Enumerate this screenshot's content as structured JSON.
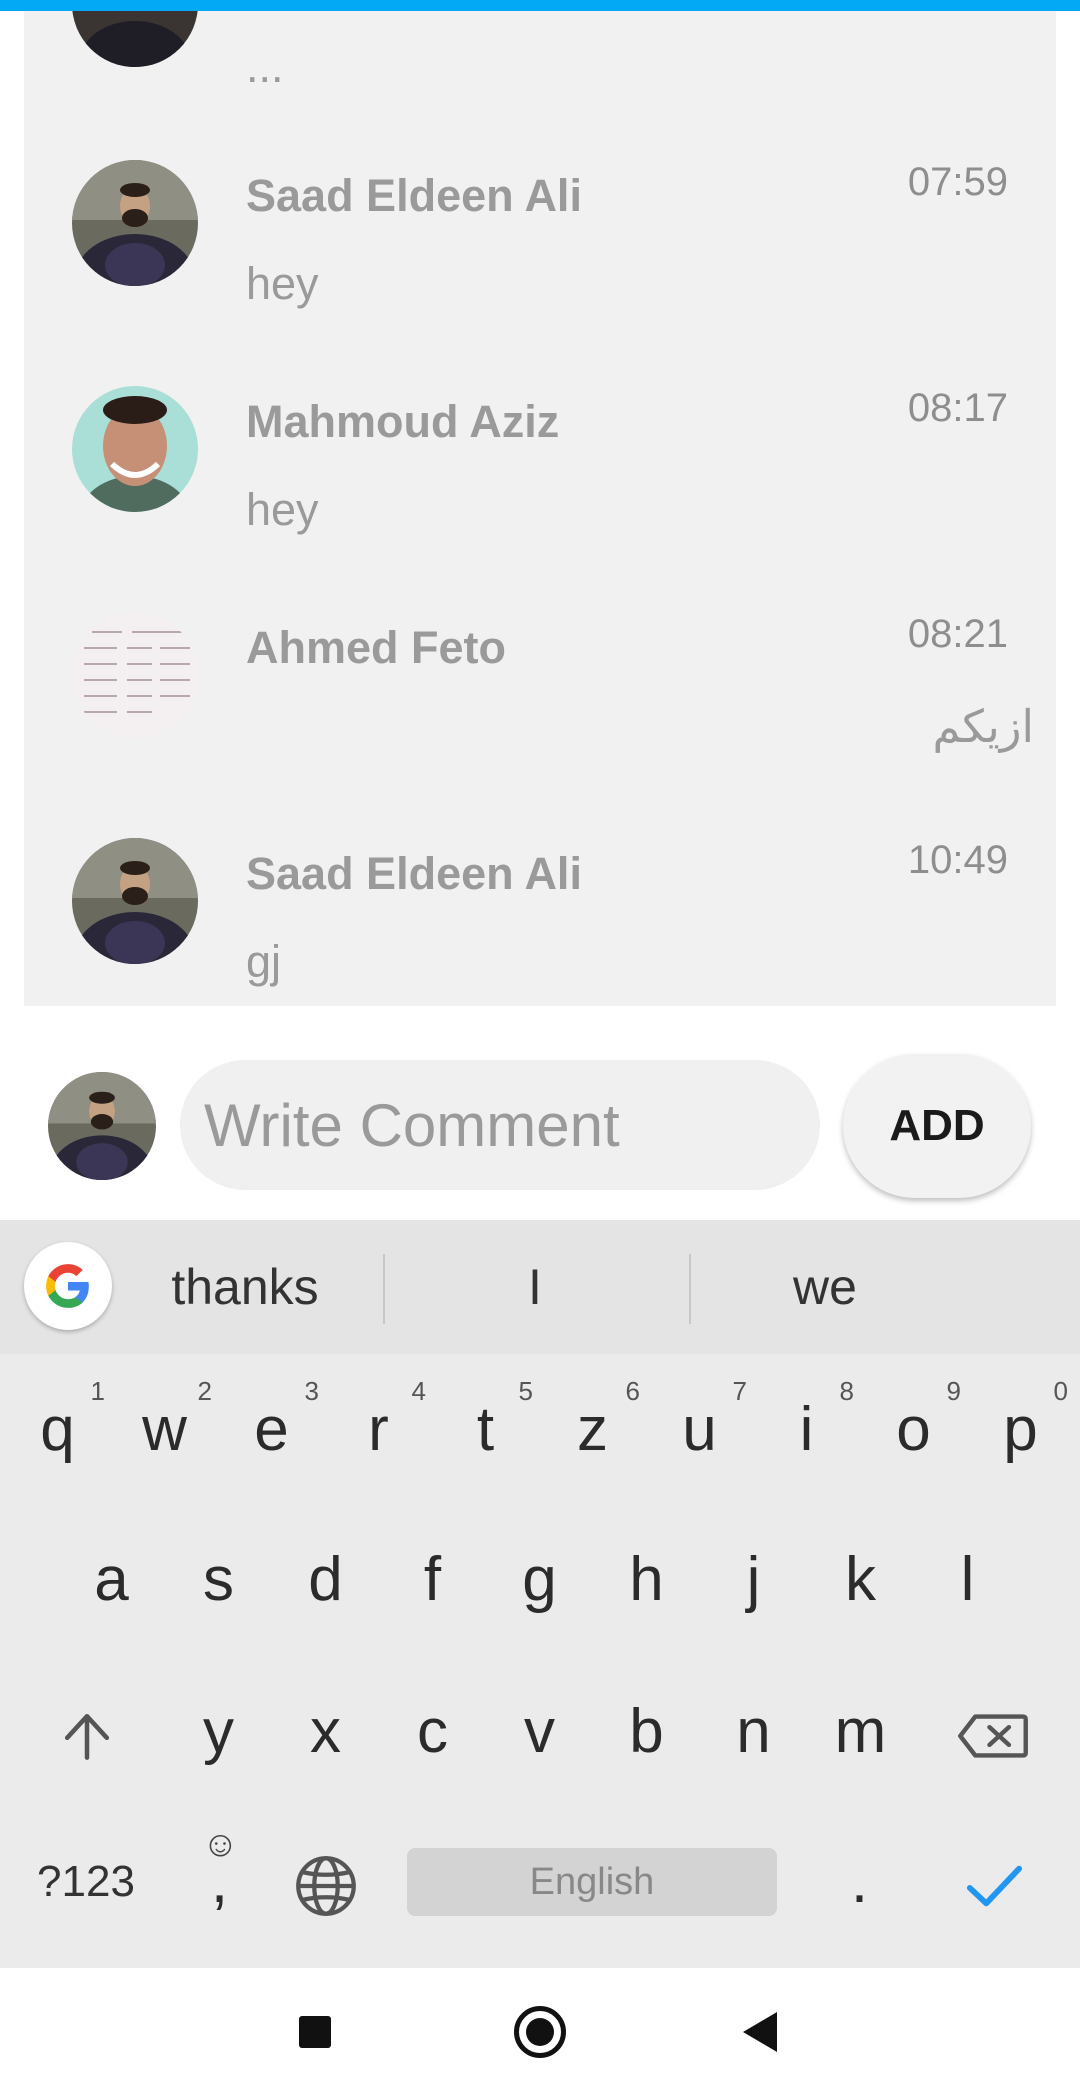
{
  "comments": [
    {
      "name": "",
      "text": "...",
      "time": ""
    },
    {
      "name": "Saad Eldeen Ali",
      "text": "hey",
      "time": "07:59"
    },
    {
      "name": "Mahmoud Aziz",
      "text": "hey",
      "time": "08:17"
    },
    {
      "name": "Ahmed Feto",
      "text": "ازيكم",
      "time": "08:21"
    },
    {
      "name": "Saad Eldeen Ali",
      "text": "gj",
      "time": "10:49"
    }
  ],
  "compose": {
    "placeholder": "Write Comment",
    "add_label": "ADD"
  },
  "keyboard": {
    "suggestions": [
      "thanks",
      "I",
      "we"
    ],
    "row1": [
      "q",
      "w",
      "e",
      "r",
      "t",
      "z",
      "u",
      "i",
      "o",
      "p"
    ],
    "row1_hints": [
      "1",
      "2",
      "3",
      "4",
      "5",
      "6",
      "7",
      "8",
      "9",
      "0"
    ],
    "row2": [
      "a",
      "s",
      "d",
      "f",
      "g",
      "h",
      "j",
      "k",
      "l"
    ],
    "row3": [
      "y",
      "x",
      "c",
      "v",
      "b",
      "n",
      "m"
    ],
    "symbols_label": "?123",
    "comma_label": ",",
    "period_label": ".",
    "space_label": "English"
  },
  "colors": {
    "accent_bar": "#03A9F4",
    "enter_check": "#2196F3"
  },
  "icons": {
    "shift": "shift-arrow-icon",
    "backspace": "backspace-icon",
    "emoji": "smiley-icon",
    "language": "globe-icon",
    "enter": "checkmark-icon",
    "nav_recent": "square-icon",
    "nav_home": "circle-icon",
    "nav_back": "triangle-back-icon"
  }
}
